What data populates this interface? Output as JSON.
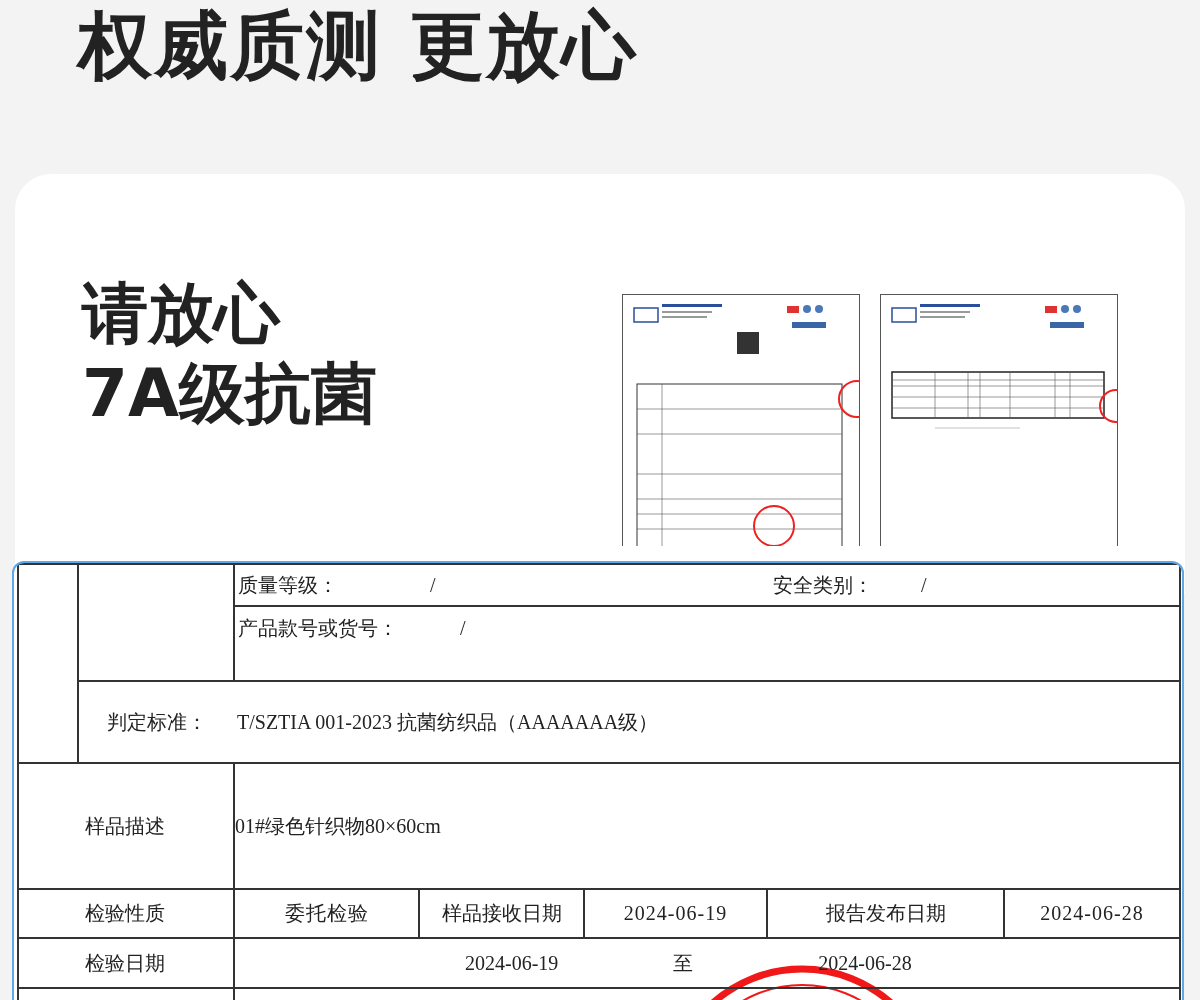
{
  "headline": "权威质测 更放心",
  "card": {
    "title_lines": [
      "请放心",
      "7A级抗菌"
    ],
    "report_pages": [
      {
        "kind": "cover"
      },
      {
        "kind": "results"
      }
    ]
  },
  "report_detail": {
    "quality_grade": {
      "label": "质量等级：",
      "value": "/"
    },
    "safety_category": {
      "label": "安全类别：",
      "value": "/"
    },
    "style_number": {
      "label": "产品款号或货号：",
      "value": "/"
    },
    "standard": {
      "label": "判定标准：",
      "value": "T/SZTIA 001-2023 抗菌纺织品（AAAAAAA级）"
    },
    "sample_description": {
      "label": "样品描述",
      "value": "01#绿色针织物80×60cm"
    },
    "inspection_row": [
      {
        "kind": "label",
        "text": "检验性质"
      },
      {
        "kind": "value",
        "text": "委托检验"
      },
      {
        "kind": "label",
        "text": "样品接收日期"
      },
      {
        "kind": "value",
        "text": "2024-06-19"
      },
      {
        "kind": "label",
        "text": "报告发布日期"
      },
      {
        "kind": "value",
        "text": "2024-06-28"
      }
    ],
    "inspection_date": {
      "label": "检验日期",
      "from": "2024-06-19",
      "separator": "至",
      "to": "2024-06-28"
    },
    "stamp": true
  }
}
